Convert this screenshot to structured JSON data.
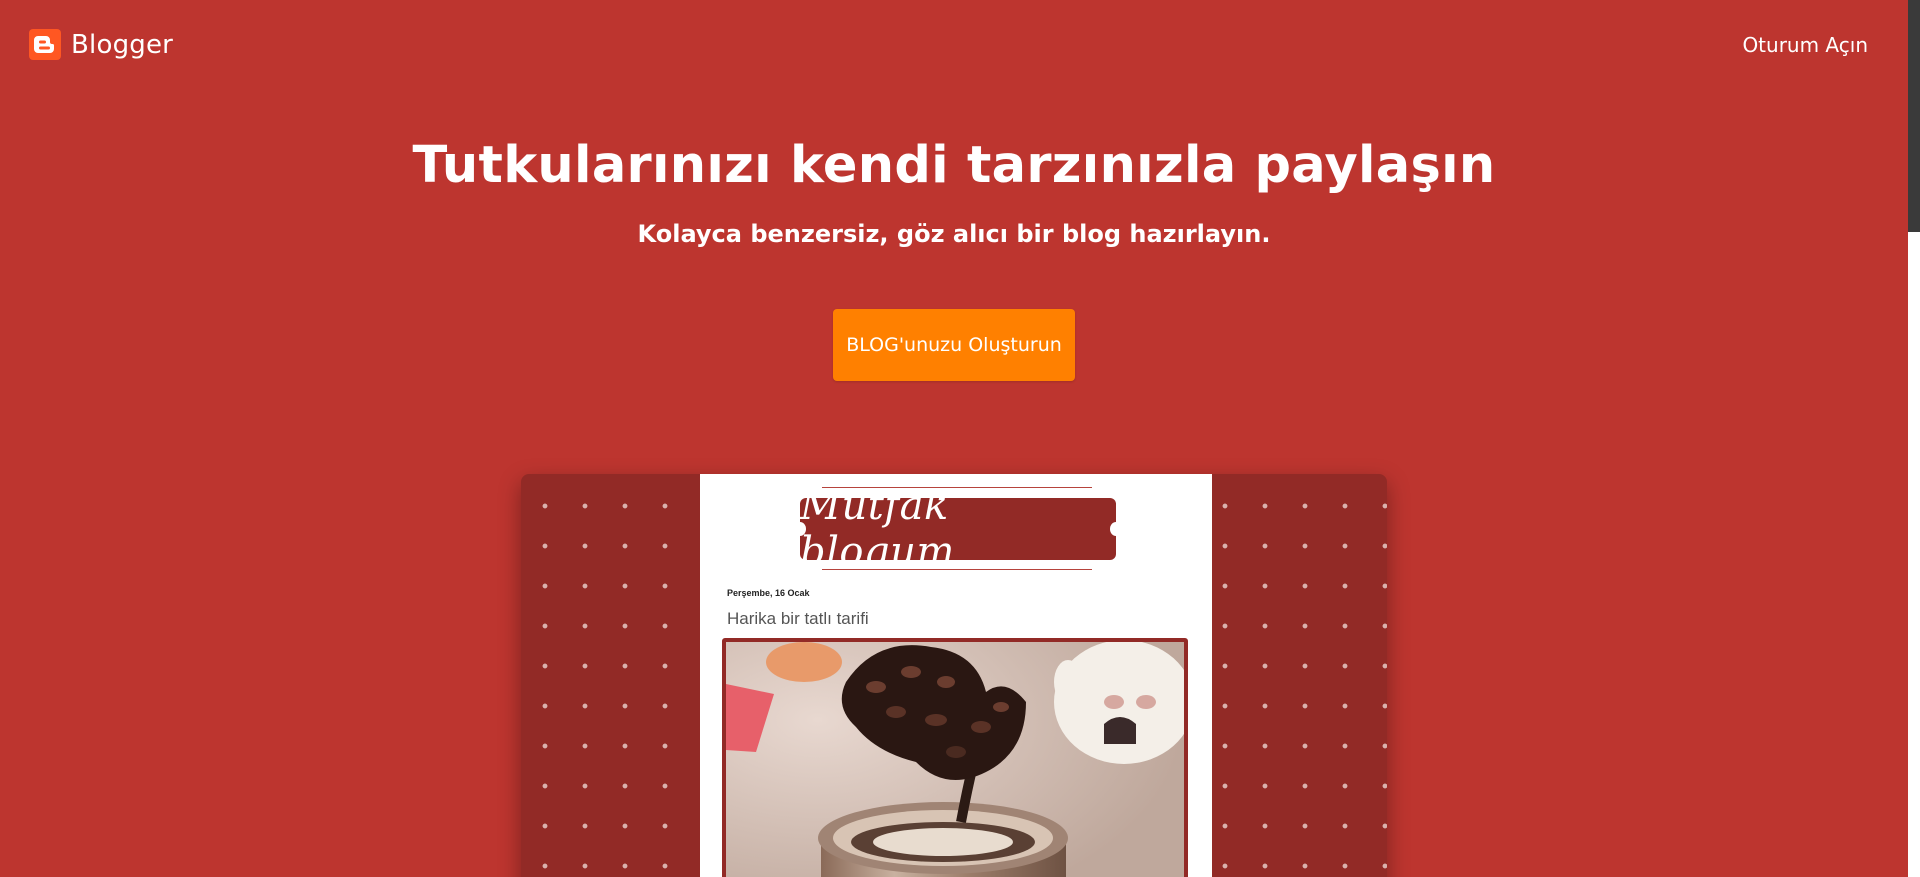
{
  "header": {
    "brand": "Blogger",
    "signin_label": "Oturum Açın"
  },
  "hero": {
    "title": "Tutkularınızı kendi tarzınızla paylaşın",
    "subtitle": "Kolayca benzersiz, göz alıcı bir blog hazırlayın.",
    "cta_label": "BLOG'unuzu Oluşturun"
  },
  "preview": {
    "blog_title": "Mutfak blogum",
    "post_date": "Perşembe, 16 Ocak",
    "post_title": "Harika bir tatlı tarifi"
  },
  "colors": {
    "background": "#bd352f",
    "cta": "#ff8000",
    "brand_icon": "#ff5722",
    "blog_accent": "#922a26"
  },
  "icons": {
    "brand": "blogger-logo-icon"
  }
}
